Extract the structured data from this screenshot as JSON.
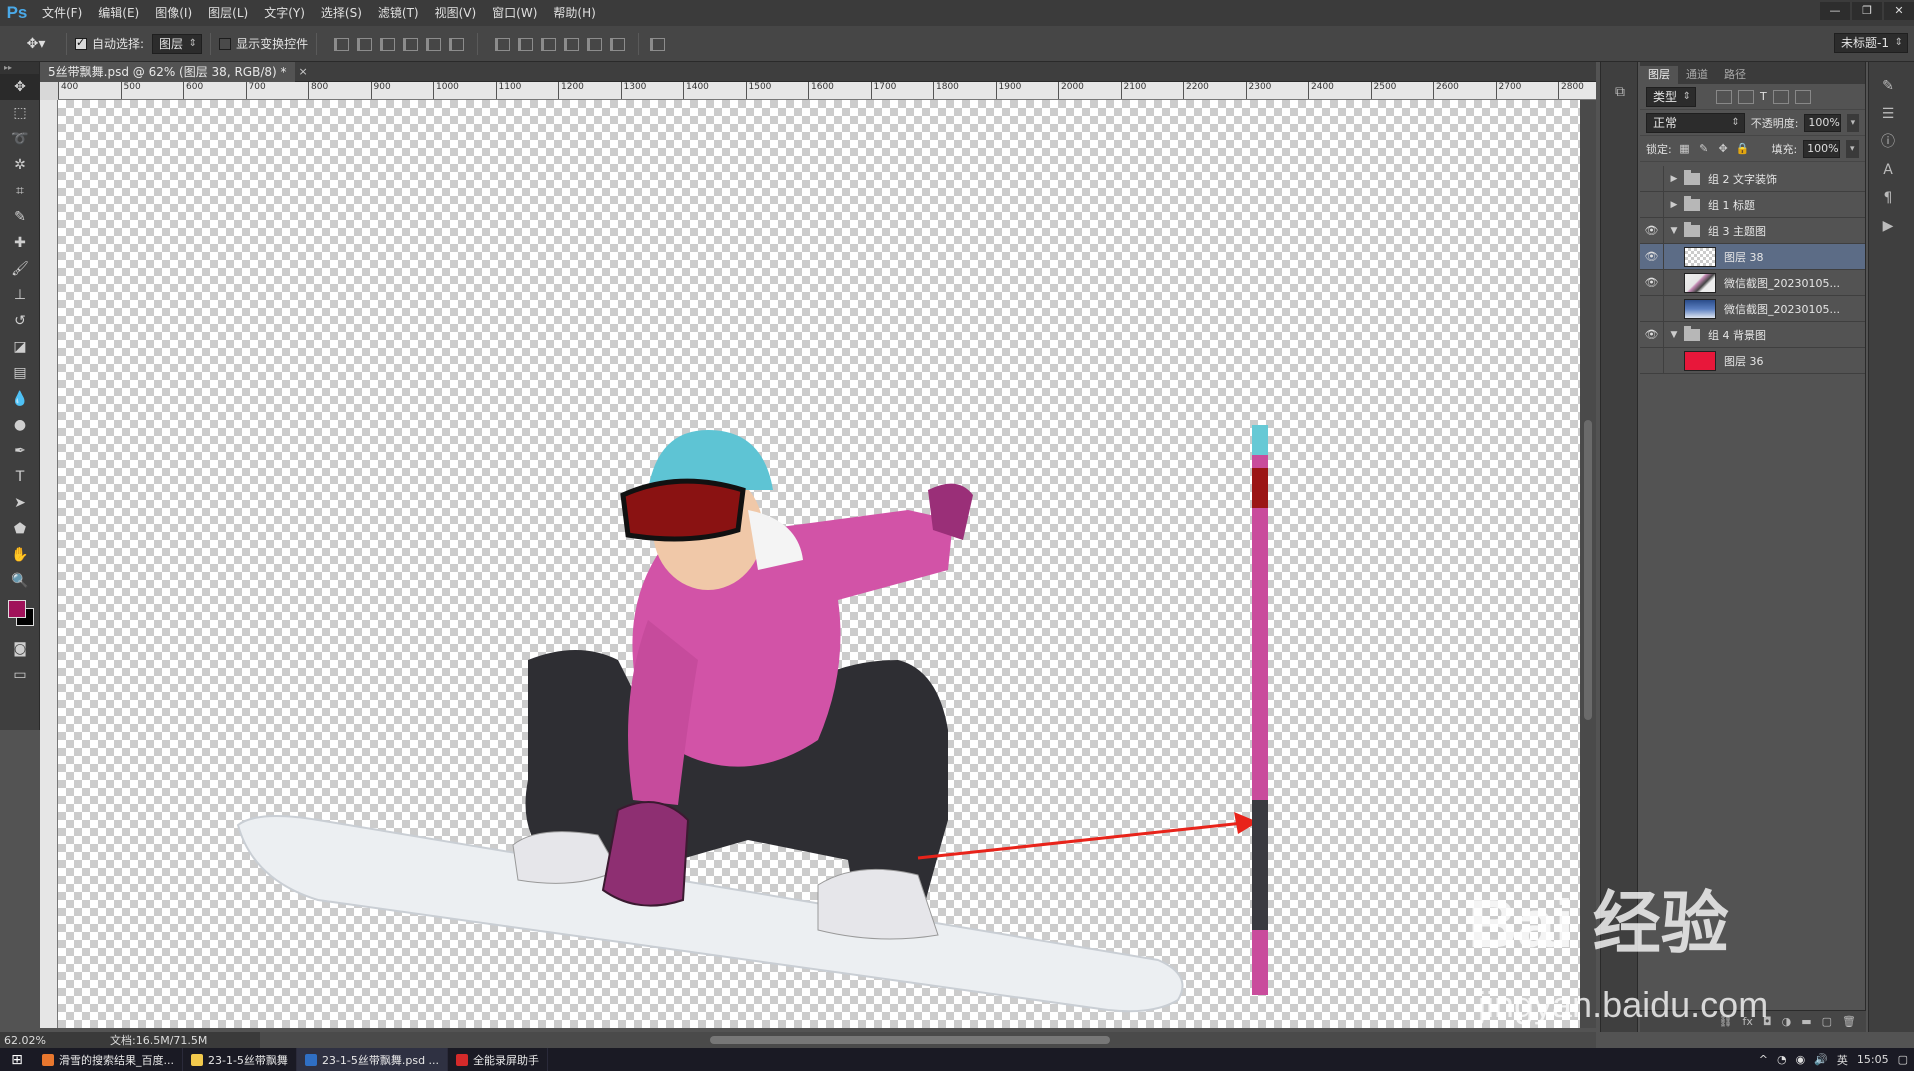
{
  "app": {
    "logo": "Ps",
    "menu": [
      "文件(F)",
      "编辑(E)",
      "图像(I)",
      "图层(L)",
      "文字(Y)",
      "选择(S)",
      "滤镜(T)",
      "视图(V)",
      "窗口(W)",
      "帮助(H)"
    ],
    "window_controls": [
      "—",
      "❐",
      "✕"
    ]
  },
  "options_bar": {
    "auto_select_label": "自动选择:",
    "auto_select_checked": true,
    "auto_select_target": "图层",
    "show_transform_label": "显示变换控件",
    "show_transform_checked": false,
    "workspace": "未标题-1"
  },
  "document": {
    "tab_title": "5丝带飘舞.psd @ 62% (图层 38, RGB/8) *",
    "close_symbol": "×",
    "ruler_ticks": [
      "400",
      "500",
      "600",
      "700",
      "800",
      "900",
      "1000",
      "1100",
      "1200",
      "1300",
      "1400",
      "1500",
      "1600",
      "1700",
      "1800",
      "1900",
      "2000",
      "2100",
      "2200",
      "2300",
      "2400",
      "2500",
      "2600",
      "2700",
      "2800"
    ]
  },
  "status": {
    "zoom": "62.02%",
    "doc_size": "文档:16.5M/71.5M"
  },
  "layers_panel": {
    "tabs": [
      "图层",
      "通道",
      "路径"
    ],
    "active_tab": "图层",
    "filter_kind": "类型",
    "blend_mode": "正常",
    "opacity_label": "不透明度:",
    "opacity": "100%",
    "lock_label": "锁定:",
    "fill_label": "填充:",
    "fill": "100%",
    "layers": [
      {
        "name": "组 2 文字装饰",
        "type": "group",
        "visible": false,
        "expanded": false,
        "indent": 0
      },
      {
        "name": "组 1 标题",
        "type": "group",
        "visible": false,
        "expanded": false,
        "indent": 0
      },
      {
        "name": "组 3 主题图",
        "type": "group",
        "visible": true,
        "expanded": true,
        "indent": 0
      },
      {
        "name": "图层 38",
        "type": "layer",
        "thumb": "checker",
        "visible": true,
        "selected": true,
        "indent": 1
      },
      {
        "name": "微信截图_20230105...",
        "type": "layer",
        "thumb": "photo1",
        "visible": true,
        "indent": 1
      },
      {
        "name": "微信截图_20230105...",
        "type": "layer",
        "thumb": "photo2",
        "visible": false,
        "indent": 1
      },
      {
        "name": "组 4 背景图",
        "type": "group",
        "visible": true,
        "expanded": true,
        "indent": 0
      },
      {
        "name": "图层 36",
        "type": "layer",
        "thumb": "red",
        "visible": false,
        "indent": 1
      }
    ],
    "footer_icons": [
      "link-icon",
      "fx-icon",
      "mask-icon",
      "adjustment-icon",
      "folder-icon",
      "new-layer-icon",
      "trash-icon"
    ]
  },
  "colors": {
    "foreground": "#a0125a",
    "background": "#000000",
    "layer36_fill": "#e8173a",
    "arrow": "#e8231a"
  },
  "taskbar": {
    "items": [
      "滑雪的搜索结果_百度...",
      "23-1-5丝带飘舞",
      "23-1-5丝带飘舞.psd ...",
      "全能录屏助手"
    ],
    "active_index": 2,
    "tray_lang": "英",
    "time": "15:05"
  },
  "watermark": {
    "brand": "Bai 经验",
    "url": "jingyan.baidu.com"
  }
}
